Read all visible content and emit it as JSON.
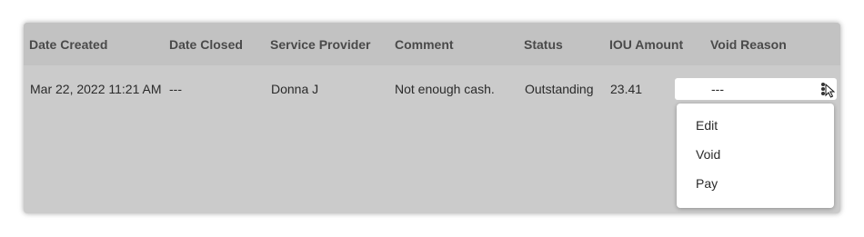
{
  "table": {
    "headers": [
      "Date Created",
      "Date Closed",
      "Service Provider",
      "Comment",
      "Status",
      "IOU Amount",
      "Void Reason"
    ],
    "rows": [
      {
        "date_created": "Mar 22, 2022 11:21 AM",
        "date_closed": "---",
        "service_provider": "Donna J",
        "comment": "Not enough cash.",
        "status": "Outstanding",
        "iou_amount": "23.41",
        "void_reason": "---"
      }
    ]
  },
  "row_menu": {
    "items": [
      "Edit",
      "Void",
      "Pay"
    ]
  },
  "icons": {
    "row_actions": "kebab-menu-icon",
    "pointer": "mouse-cursor-icon"
  },
  "colors": {
    "panel_bg": "#cbcbcb",
    "header_bg": "#c2c2c2",
    "menu_bg": "#ffffff"
  }
}
